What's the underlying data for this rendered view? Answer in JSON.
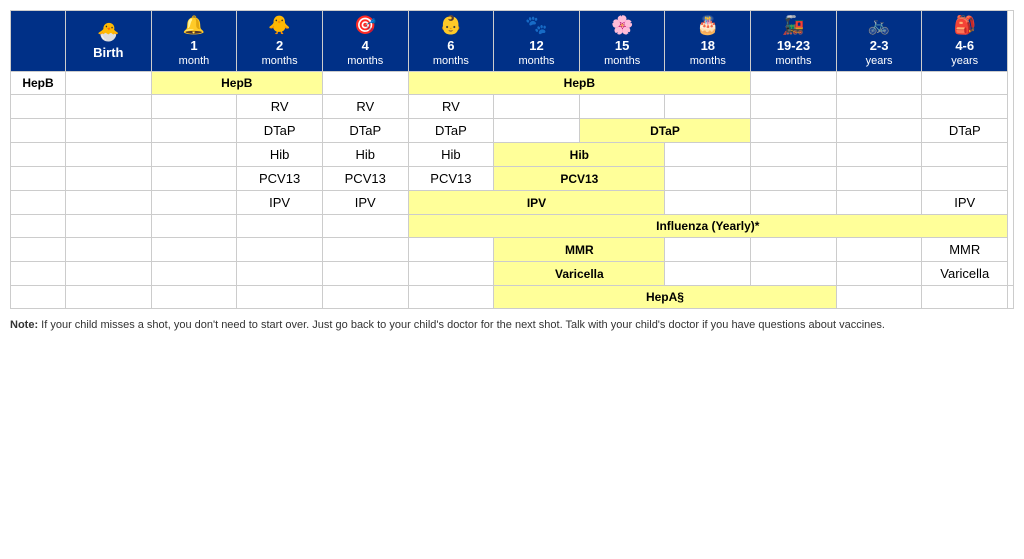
{
  "headers": [
    {
      "id": "birth",
      "icon": "🐣",
      "line1": "Birth",
      "line2": ""
    },
    {
      "id": "1mo",
      "icon": "🔔",
      "line1": "1",
      "line2": "month"
    },
    {
      "id": "2mo",
      "icon": "🐥",
      "line1": "2",
      "line2": "months"
    },
    {
      "id": "4mo",
      "icon": "🎯",
      "line1": "4",
      "line2": "months"
    },
    {
      "id": "6mo",
      "icon": "👶",
      "line1": "6",
      "line2": "months"
    },
    {
      "id": "12mo",
      "icon": "🐾",
      "line1": "12",
      "line2": "months"
    },
    {
      "id": "15mo",
      "icon": "🌸",
      "line1": "15",
      "line2": "months"
    },
    {
      "id": "18mo",
      "icon": "🎂",
      "line1": "18",
      "line2": "months"
    },
    {
      "id": "19-23mo",
      "icon": "🚂",
      "line1": "19-23",
      "line2": "months"
    },
    {
      "id": "2-3y",
      "icon": "🚲",
      "line1": "2-3",
      "line2": "years"
    },
    {
      "id": "4-6y",
      "icon": "🎒",
      "line1": "4-6",
      "line2": "years"
    }
  ],
  "rows": [
    {
      "label": "HepB",
      "cells": [
        {
          "id": "birth",
          "content": "",
          "style": ""
        },
        {
          "id": "1mo-2mo",
          "content": "HepB",
          "style": "yellow-bar",
          "colspan": 2
        },
        {
          "id": "4mo",
          "content": "",
          "style": ""
        },
        {
          "id": "6mo-18mo",
          "content": "HepB",
          "style": "yellow-bar",
          "colspan": 4
        },
        {
          "id": "19-23mo",
          "content": "",
          "style": ""
        },
        {
          "id": "2-3y",
          "content": "",
          "style": ""
        },
        {
          "id": "4-6y",
          "content": "",
          "style": ""
        }
      ]
    },
    {
      "label": "",
      "cells": [
        {
          "id": "birth",
          "content": "",
          "style": ""
        },
        {
          "id": "1mo",
          "content": "",
          "style": ""
        },
        {
          "id": "2mo",
          "content": "RV",
          "style": "vaccine-name"
        },
        {
          "id": "4mo",
          "content": "RV",
          "style": "vaccine-name"
        },
        {
          "id": "6mo",
          "content": "RV",
          "style": "vaccine-name"
        },
        {
          "id": "12mo",
          "content": "",
          "style": ""
        },
        {
          "id": "15mo",
          "content": "",
          "style": ""
        },
        {
          "id": "18mo",
          "content": "",
          "style": ""
        },
        {
          "id": "19-23mo",
          "content": "",
          "style": ""
        },
        {
          "id": "2-3y",
          "content": "",
          "style": ""
        },
        {
          "id": "4-6y",
          "content": "",
          "style": ""
        }
      ]
    },
    {
      "label": "",
      "cells": [
        {
          "id": "birth",
          "content": "",
          "style": ""
        },
        {
          "id": "1mo",
          "content": "",
          "style": ""
        },
        {
          "id": "2mo",
          "content": "DTaP",
          "style": "vaccine-name"
        },
        {
          "id": "4mo",
          "content": "DTaP",
          "style": "vaccine-name"
        },
        {
          "id": "6mo",
          "content": "DTaP",
          "style": "vaccine-name"
        },
        {
          "id": "12mo",
          "content": "",
          "style": ""
        },
        {
          "id": "15mo-18mo",
          "content": "DTaP",
          "style": "yellow-bar",
          "colspan": 2
        },
        {
          "id": "19-23mo",
          "content": "",
          "style": ""
        },
        {
          "id": "2-3y",
          "content": "",
          "style": ""
        },
        {
          "id": "4-6y",
          "content": "DTaP",
          "style": "vaccine-name"
        }
      ]
    },
    {
      "label": "",
      "cells": [
        {
          "id": "birth",
          "content": "",
          "style": ""
        },
        {
          "id": "1mo",
          "content": "",
          "style": ""
        },
        {
          "id": "2mo",
          "content": "Hib",
          "style": "vaccine-name"
        },
        {
          "id": "4mo",
          "content": "Hib",
          "style": "vaccine-name"
        },
        {
          "id": "6mo",
          "content": "Hib",
          "style": "vaccine-name"
        },
        {
          "id": "12mo-15mo",
          "content": "Hib",
          "style": "yellow-bar",
          "colspan": 2
        },
        {
          "id": "18mo",
          "content": "",
          "style": ""
        },
        {
          "id": "19-23mo",
          "content": "",
          "style": ""
        },
        {
          "id": "2-3y",
          "content": "",
          "style": ""
        },
        {
          "id": "4-6y",
          "content": "",
          "style": ""
        }
      ]
    },
    {
      "label": "",
      "cells": [
        {
          "id": "birth",
          "content": "",
          "style": ""
        },
        {
          "id": "1mo",
          "content": "",
          "style": ""
        },
        {
          "id": "2mo",
          "content": "PCV13",
          "style": "vaccine-name"
        },
        {
          "id": "4mo",
          "content": "PCV13",
          "style": "vaccine-name"
        },
        {
          "id": "6mo",
          "content": "PCV13",
          "style": "vaccine-name"
        },
        {
          "id": "12mo-15mo",
          "content": "PCV13",
          "style": "yellow-bar",
          "colspan": 2
        },
        {
          "id": "18mo",
          "content": "",
          "style": ""
        },
        {
          "id": "19-23mo",
          "content": "",
          "style": ""
        },
        {
          "id": "2-3y",
          "content": "",
          "style": ""
        },
        {
          "id": "4-6y",
          "content": "",
          "style": ""
        }
      ]
    },
    {
      "label": "",
      "cells": [
        {
          "id": "birth",
          "content": "",
          "style": ""
        },
        {
          "id": "1mo",
          "content": "",
          "style": ""
        },
        {
          "id": "2mo",
          "content": "IPV",
          "style": "vaccine-name"
        },
        {
          "id": "4mo",
          "content": "IPV",
          "style": "vaccine-name"
        },
        {
          "id": "6mo-15mo",
          "content": "IPV",
          "style": "yellow-bar",
          "colspan": 3
        },
        {
          "id": "18mo",
          "content": "",
          "style": ""
        },
        {
          "id": "19-23mo",
          "content": "",
          "style": ""
        },
        {
          "id": "2-3y",
          "content": "",
          "style": ""
        },
        {
          "id": "4-6y",
          "content": "IPV",
          "style": "vaccine-name"
        }
      ]
    },
    {
      "label": "",
      "cells": [
        {
          "id": "birth",
          "content": "",
          "style": ""
        },
        {
          "id": "1mo",
          "content": "",
          "style": ""
        },
        {
          "id": "2mo",
          "content": "",
          "style": ""
        },
        {
          "id": "4mo",
          "content": "",
          "style": ""
        },
        {
          "id": "6mo-4-6y",
          "content": "Influenza (Yearly)*",
          "style": "yellow-bar",
          "colspan": 7
        }
      ]
    },
    {
      "label": "",
      "cells": [
        {
          "id": "birth",
          "content": "",
          "style": ""
        },
        {
          "id": "1mo",
          "content": "",
          "style": ""
        },
        {
          "id": "2mo",
          "content": "",
          "style": ""
        },
        {
          "id": "4mo",
          "content": "",
          "style": ""
        },
        {
          "id": "6mo",
          "content": "",
          "style": ""
        },
        {
          "id": "12mo-15mo",
          "content": "MMR",
          "style": "yellow-bar",
          "colspan": 2
        },
        {
          "id": "18mo",
          "content": "",
          "style": ""
        },
        {
          "id": "19-23mo",
          "content": "",
          "style": ""
        },
        {
          "id": "2-3y",
          "content": "",
          "style": ""
        },
        {
          "id": "4-6y",
          "content": "MMR",
          "style": "vaccine-name"
        }
      ]
    },
    {
      "label": "",
      "cells": [
        {
          "id": "birth",
          "content": "",
          "style": ""
        },
        {
          "id": "1mo",
          "content": "",
          "style": ""
        },
        {
          "id": "2mo",
          "content": "",
          "style": ""
        },
        {
          "id": "4mo",
          "content": "",
          "style": ""
        },
        {
          "id": "6mo",
          "content": "",
          "style": ""
        },
        {
          "id": "12mo-15mo",
          "content": "Varicella",
          "style": "yellow-bar",
          "colspan": 2
        },
        {
          "id": "18mo",
          "content": "",
          "style": ""
        },
        {
          "id": "19-23mo",
          "content": "",
          "style": ""
        },
        {
          "id": "2-3y",
          "content": "",
          "style": ""
        },
        {
          "id": "4-6y",
          "content": "Varicella",
          "style": "vaccine-name"
        }
      ]
    },
    {
      "label": "",
      "cells": [
        {
          "id": "birth",
          "content": "",
          "style": ""
        },
        {
          "id": "1mo",
          "content": "",
          "style": ""
        },
        {
          "id": "2mo",
          "content": "",
          "style": ""
        },
        {
          "id": "4mo",
          "content": "",
          "style": ""
        },
        {
          "id": "6mo",
          "content": "",
          "style": ""
        },
        {
          "id": "12mo-18mo",
          "content": "HepA§",
          "style": "yellow-bar",
          "colspan": 4
        },
        {
          "id": "19-23mo",
          "content": "",
          "style": ""
        },
        {
          "id": "2-3y",
          "content": "",
          "style": ""
        },
        {
          "id": "4-6y",
          "content": "",
          "style": ""
        }
      ]
    }
  ],
  "note": "If your child misses a shot, you don't need to start over. Just go back to your child's doctor for the next shot. Talk with your child's doctor if you have questions about vaccines.",
  "note_label": "Note:"
}
